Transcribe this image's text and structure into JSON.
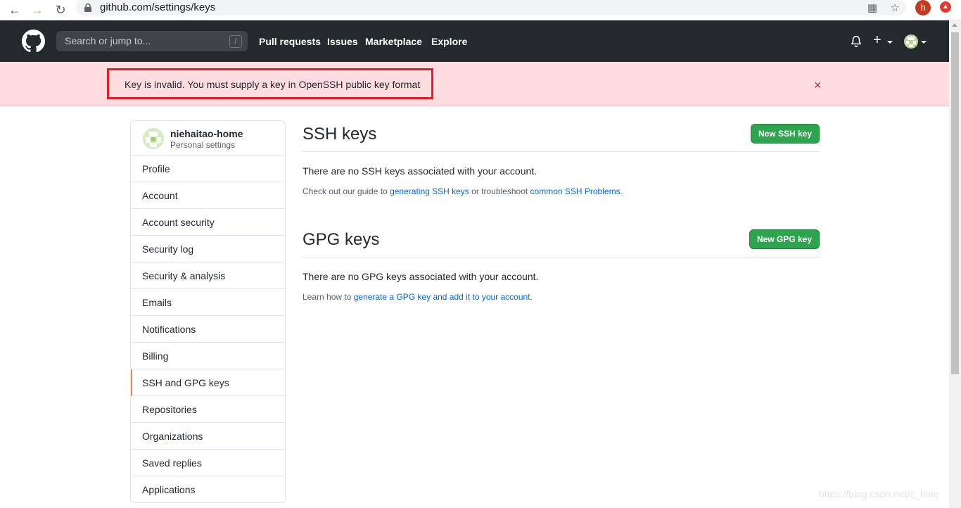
{
  "browser": {
    "url": "github.com/settings/keys",
    "profile_initial": "h"
  },
  "header": {
    "search_placeholder": "Search or jump to...",
    "search_shortcut": "/",
    "nav": [
      "Pull requests",
      "Issues",
      "Marketplace",
      "Explore"
    ],
    "plus": "+"
  },
  "flash": {
    "message": "Key is invalid. You must supply a key in OpenSSH public key format",
    "close": "×"
  },
  "sidebar": {
    "username": "niehaitao-home",
    "subtitle": "Personal settings",
    "items": [
      {
        "label": "Profile"
      },
      {
        "label": "Account"
      },
      {
        "label": "Account security"
      },
      {
        "label": "Security log"
      },
      {
        "label": "Security & analysis"
      },
      {
        "label": "Emails"
      },
      {
        "label": "Notifications"
      },
      {
        "label": "Billing"
      },
      {
        "label": "SSH and GPG keys"
      },
      {
        "label": "Repositories"
      },
      {
        "label": "Organizations"
      },
      {
        "label": "Saved replies"
      },
      {
        "label": "Applications"
      }
    ],
    "active_index": 8
  },
  "ssh": {
    "title": "SSH keys",
    "button": "New SSH key",
    "empty": "There are no SSH keys associated with your account.",
    "note_prefix": "Check out our guide to ",
    "link1": "generating SSH keys",
    "note_mid": " or troubleshoot ",
    "link2": "common SSH Problems",
    "note_suffix": "."
  },
  "gpg": {
    "title": "GPG keys",
    "button": "New GPG key",
    "empty": "There are no GPG keys associated with your account.",
    "note_prefix": "Learn how to ",
    "link": "generate a GPG key and add it to your account",
    "note_suffix": "."
  },
  "watermark": "https://blog.csdn.net/c_hnie",
  "colors": {
    "header_bg": "#24292e",
    "flash_bg": "#ffdce0",
    "flash_outline": "#d9202b",
    "button_green": "#2ea44f",
    "link": "#0366d6",
    "active_marker": "#f9826c"
  }
}
